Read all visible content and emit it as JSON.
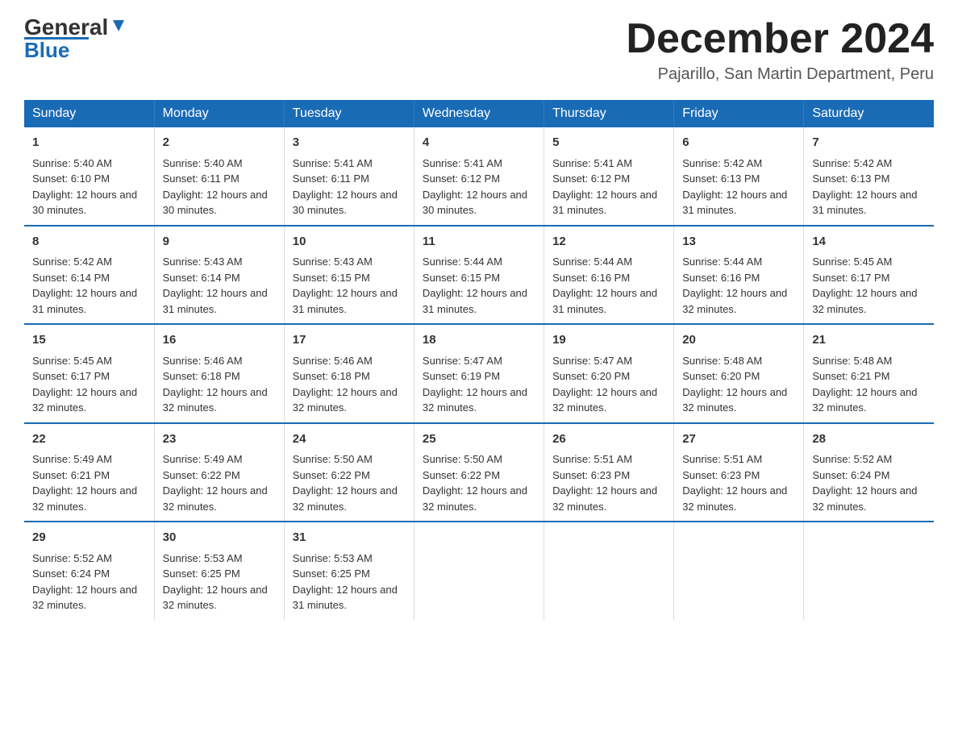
{
  "header": {
    "logo_general": "General",
    "logo_blue": "Blue",
    "month_title": "December 2024",
    "location": "Pajarillo, San Martin Department, Peru"
  },
  "weekdays": [
    "Sunday",
    "Monday",
    "Tuesday",
    "Wednesday",
    "Thursday",
    "Friday",
    "Saturday"
  ],
  "weeks": [
    [
      {
        "day": "1",
        "sunrise": "5:40 AM",
        "sunset": "6:10 PM",
        "daylight": "12 hours and 30 minutes."
      },
      {
        "day": "2",
        "sunrise": "5:40 AM",
        "sunset": "6:11 PM",
        "daylight": "12 hours and 30 minutes."
      },
      {
        "day": "3",
        "sunrise": "5:41 AM",
        "sunset": "6:11 PM",
        "daylight": "12 hours and 30 minutes."
      },
      {
        "day": "4",
        "sunrise": "5:41 AM",
        "sunset": "6:12 PM",
        "daylight": "12 hours and 30 minutes."
      },
      {
        "day": "5",
        "sunrise": "5:41 AM",
        "sunset": "6:12 PM",
        "daylight": "12 hours and 31 minutes."
      },
      {
        "day": "6",
        "sunrise": "5:42 AM",
        "sunset": "6:13 PM",
        "daylight": "12 hours and 31 minutes."
      },
      {
        "day": "7",
        "sunrise": "5:42 AM",
        "sunset": "6:13 PM",
        "daylight": "12 hours and 31 minutes."
      }
    ],
    [
      {
        "day": "8",
        "sunrise": "5:42 AM",
        "sunset": "6:14 PM",
        "daylight": "12 hours and 31 minutes."
      },
      {
        "day": "9",
        "sunrise": "5:43 AM",
        "sunset": "6:14 PM",
        "daylight": "12 hours and 31 minutes."
      },
      {
        "day": "10",
        "sunrise": "5:43 AM",
        "sunset": "6:15 PM",
        "daylight": "12 hours and 31 minutes."
      },
      {
        "day": "11",
        "sunrise": "5:44 AM",
        "sunset": "6:15 PM",
        "daylight": "12 hours and 31 minutes."
      },
      {
        "day": "12",
        "sunrise": "5:44 AM",
        "sunset": "6:16 PM",
        "daylight": "12 hours and 31 minutes."
      },
      {
        "day": "13",
        "sunrise": "5:44 AM",
        "sunset": "6:16 PM",
        "daylight": "12 hours and 32 minutes."
      },
      {
        "day": "14",
        "sunrise": "5:45 AM",
        "sunset": "6:17 PM",
        "daylight": "12 hours and 32 minutes."
      }
    ],
    [
      {
        "day": "15",
        "sunrise": "5:45 AM",
        "sunset": "6:17 PM",
        "daylight": "12 hours and 32 minutes."
      },
      {
        "day": "16",
        "sunrise": "5:46 AM",
        "sunset": "6:18 PM",
        "daylight": "12 hours and 32 minutes."
      },
      {
        "day": "17",
        "sunrise": "5:46 AM",
        "sunset": "6:18 PM",
        "daylight": "12 hours and 32 minutes."
      },
      {
        "day": "18",
        "sunrise": "5:47 AM",
        "sunset": "6:19 PM",
        "daylight": "12 hours and 32 minutes."
      },
      {
        "day": "19",
        "sunrise": "5:47 AM",
        "sunset": "6:20 PM",
        "daylight": "12 hours and 32 minutes."
      },
      {
        "day": "20",
        "sunrise": "5:48 AM",
        "sunset": "6:20 PM",
        "daylight": "12 hours and 32 minutes."
      },
      {
        "day": "21",
        "sunrise": "5:48 AM",
        "sunset": "6:21 PM",
        "daylight": "12 hours and 32 minutes."
      }
    ],
    [
      {
        "day": "22",
        "sunrise": "5:49 AM",
        "sunset": "6:21 PM",
        "daylight": "12 hours and 32 minutes."
      },
      {
        "day": "23",
        "sunrise": "5:49 AM",
        "sunset": "6:22 PM",
        "daylight": "12 hours and 32 minutes."
      },
      {
        "day": "24",
        "sunrise": "5:50 AM",
        "sunset": "6:22 PM",
        "daylight": "12 hours and 32 minutes."
      },
      {
        "day": "25",
        "sunrise": "5:50 AM",
        "sunset": "6:22 PM",
        "daylight": "12 hours and 32 minutes."
      },
      {
        "day": "26",
        "sunrise": "5:51 AM",
        "sunset": "6:23 PM",
        "daylight": "12 hours and 32 minutes."
      },
      {
        "day": "27",
        "sunrise": "5:51 AM",
        "sunset": "6:23 PM",
        "daylight": "12 hours and 32 minutes."
      },
      {
        "day": "28",
        "sunrise": "5:52 AM",
        "sunset": "6:24 PM",
        "daylight": "12 hours and 32 minutes."
      }
    ],
    [
      {
        "day": "29",
        "sunrise": "5:52 AM",
        "sunset": "6:24 PM",
        "daylight": "12 hours and 32 minutes."
      },
      {
        "day": "30",
        "sunrise": "5:53 AM",
        "sunset": "6:25 PM",
        "daylight": "12 hours and 32 minutes."
      },
      {
        "day": "31",
        "sunrise": "5:53 AM",
        "sunset": "6:25 PM",
        "daylight": "12 hours and 31 minutes."
      },
      null,
      null,
      null,
      null
    ]
  ]
}
